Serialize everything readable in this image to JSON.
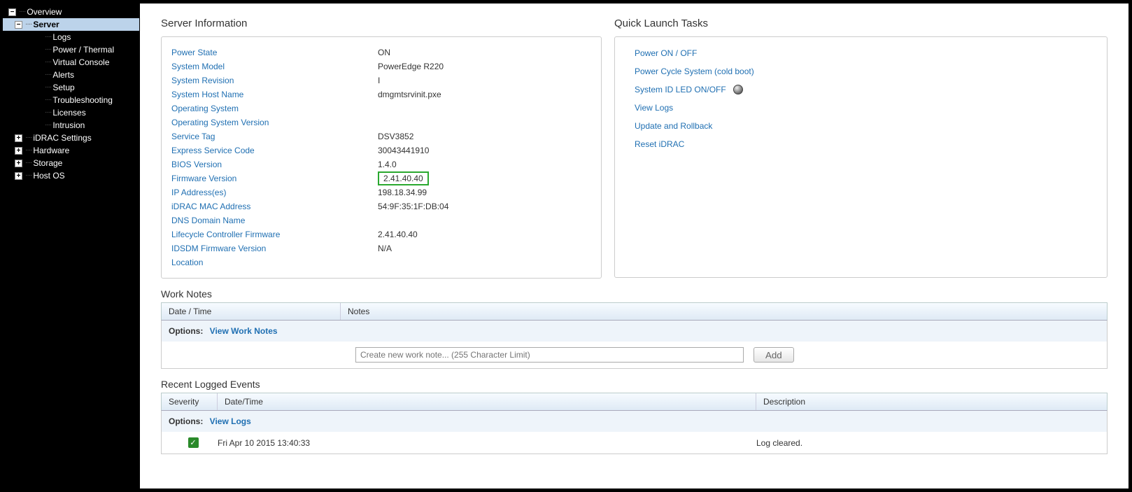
{
  "nav": {
    "overview": "Overview",
    "server": "Server",
    "logs": "Logs",
    "power_thermal": "Power / Thermal",
    "virtual_console": "Virtual Console",
    "alerts": "Alerts",
    "setup": "Setup",
    "troubleshooting": "Troubleshooting",
    "licenses": "Licenses",
    "intrusion": "Intrusion",
    "idrac_settings": "iDRAC Settings",
    "hardware": "Hardware",
    "storage": "Storage",
    "host_os": "Host OS"
  },
  "server_info": {
    "title": "Server Information",
    "rows": {
      "power_state": {
        "k": "Power State",
        "v": "ON"
      },
      "system_model": {
        "k": "System Model",
        "v": "PowerEdge R220"
      },
      "system_revision": {
        "k": "System Revision",
        "v": "I"
      },
      "system_host_name": {
        "k": "System Host Name",
        "v": "dmgmtsrvinit.pxe"
      },
      "operating_system": {
        "k": "Operating System",
        "v": ""
      },
      "os_version": {
        "k": "Operating System Version",
        "v": ""
      },
      "service_tag": {
        "k": "Service Tag",
        "v": "DSV3852"
      },
      "express_service_code": {
        "k": "Express Service Code",
        "v": "30043441910"
      },
      "bios_version": {
        "k": "BIOS Version",
        "v": "1.4.0"
      },
      "firmware_version": {
        "k": "Firmware Version",
        "v": "2.41.40.40"
      },
      "ip_addresses": {
        "k": "IP Address(es)",
        "v": "198.18.34.99"
      },
      "idrac_mac": {
        "k": "iDRAC MAC Address",
        "v": "54:9F:35:1F:DB:04"
      },
      "dns_domain": {
        "k": "DNS Domain Name",
        "v": ""
      },
      "lifecycle_fw": {
        "k": "Lifecycle Controller Firmware",
        "v": "2.41.40.40"
      },
      "idsdm_fw": {
        "k": "IDSDM Firmware Version",
        "v": "N/A"
      },
      "location": {
        "k": "Location",
        "v": ""
      }
    }
  },
  "quick_launch": {
    "title": "Quick Launch Tasks",
    "power_on_off": "Power ON / OFF",
    "power_cycle": "Power Cycle System (cold boot)",
    "system_id_led": "System ID LED ON/OFF",
    "view_logs": "View Logs",
    "update_rollback": "Update and Rollback",
    "reset_idrac": "Reset iDRAC"
  },
  "work_notes": {
    "title": "Work Notes",
    "col_date": "Date / Time",
    "col_notes": "Notes",
    "options_label": "Options:",
    "view_link": "View Work Notes",
    "placeholder": "Create new work note... (255 Character Limit)",
    "add_label": "Add"
  },
  "events": {
    "title": "Recent Logged Events",
    "col_severity": "Severity",
    "col_datetime": "Date/Time",
    "col_description": "Description",
    "options_label": "Options:",
    "view_link": "View Logs",
    "row1": {
      "datetime": "Fri Apr 10 2015 13:40:33",
      "description": "Log cleared."
    }
  }
}
